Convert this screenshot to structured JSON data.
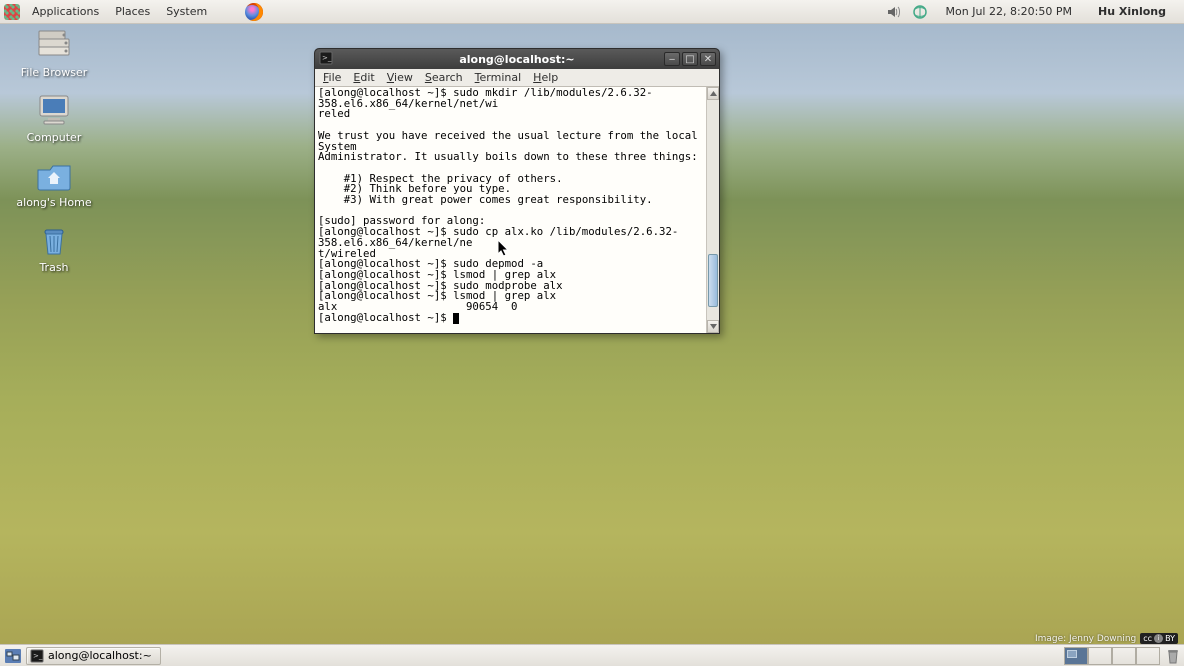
{
  "top_panel": {
    "menus": [
      "Applications",
      "Places",
      "System"
    ],
    "clock": "Mon Jul 22,  8:20:50 PM",
    "user": "Hu Xinlong"
  },
  "desktop_icons": [
    {
      "name": "file-browser-icon",
      "label": "File Browser"
    },
    {
      "name": "computer-icon",
      "label": "Computer"
    },
    {
      "name": "home-folder-icon",
      "label": "along's Home"
    },
    {
      "name": "trash-icon",
      "label": "Trash"
    }
  ],
  "window": {
    "title": "along@localhost:~",
    "menus": [
      "File",
      "Edit",
      "View",
      "Search",
      "Terminal",
      "Help"
    ],
    "terminal_lines": "[along@localhost ~]$ sudo mkdir /lib/modules/2.6.32-358.el6.x86_64/kernel/net/wi\nreled\n\nWe trust you have received the usual lecture from the local System\nAdministrator. It usually boils down to these three things:\n\n    #1) Respect the privacy of others.\n    #2) Think before you type.\n    #3) With great power comes great responsibility.\n\n[sudo] password for along:\n[along@localhost ~]$ sudo cp alx.ko /lib/modules/2.6.32-358.el6.x86_64/kernel/ne\nt/wireled\n[along@localhost ~]$ sudo depmod -a\n[along@localhost ~]$ lsmod | grep alx\n[along@localhost ~]$ sudo modprobe alx\n[along@localhost ~]$ lsmod | grep alx\nalx                    90654  0\n[along@localhost ~]$ "
  },
  "attribution": {
    "text": "Image: Jenny Downing",
    "license_cc": "cc",
    "license_by": "BY"
  },
  "bottom_panel": {
    "task_label": "along@localhost:~",
    "workspaces": 4,
    "active_ws": 0
  }
}
